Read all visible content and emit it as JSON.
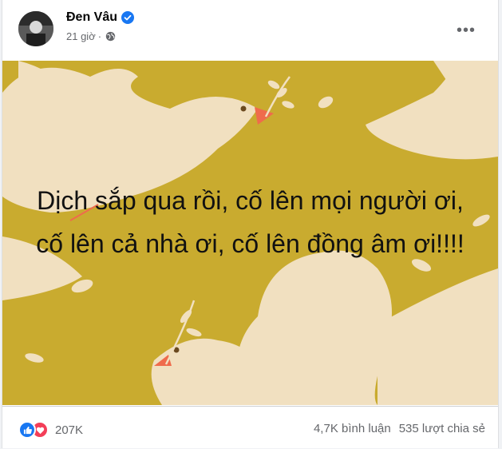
{
  "post": {
    "author": "Đen Vâu",
    "time": "21 giờ",
    "separator": "·",
    "image_text": "Dịch sắp qua rồi, cố lên mọi người ơi, cố lên cả nhà ơi, cố lên đồng âm ơi!!!!",
    "reactions_count": "207K",
    "comments": "4,7K bình luận",
    "shares": "535 lượt chia sẻ"
  },
  "icons": {
    "verified": "verified-badge-icon",
    "privacy": "globe-icon",
    "more": "more-options-icon",
    "like": "like-icon",
    "love": "love-icon"
  },
  "colors": {
    "image_background": "#c9ab2f",
    "dove": "#f1e0c0",
    "beak": "#ef6b4c",
    "like": "#1877f2",
    "love": "#f33e58"
  }
}
